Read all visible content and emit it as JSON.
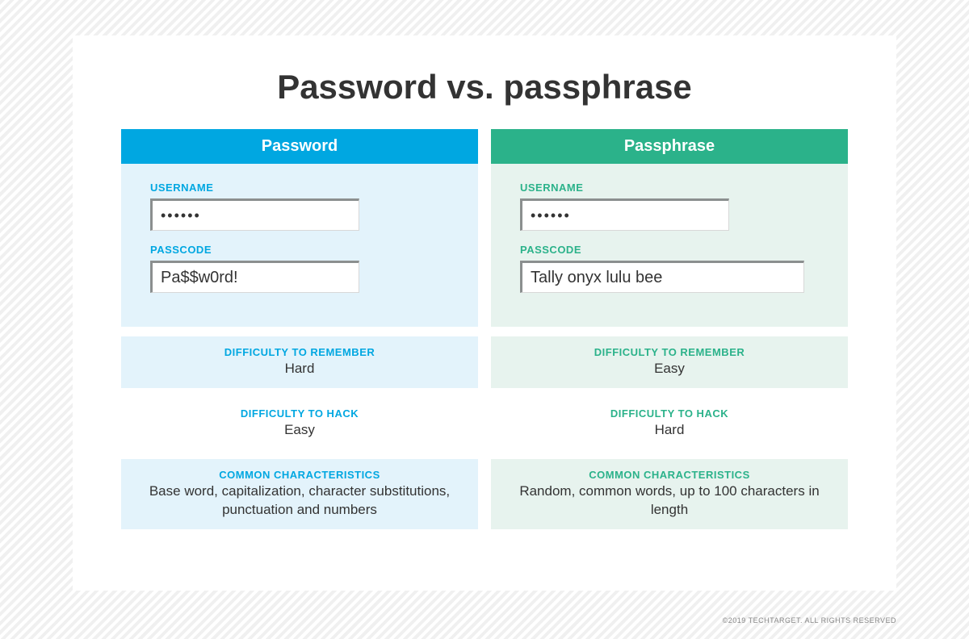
{
  "title": "Password vs. passphrase",
  "copyright": "©2019 TECHTARGET. ALL RIGHTS RESERVED",
  "labels": {
    "username": "USERNAME",
    "passcode": "PASSCODE",
    "difficulty_remember": "DIFFICULTY TO REMEMBER",
    "difficulty_hack": "DIFFICULTY TO HACK",
    "characteristics": "COMMON CHARACTERISTICS"
  },
  "password": {
    "header": "Password",
    "username_value": "••••••",
    "passcode_value": "Pa$$w0rd!",
    "difficulty_remember": "Hard",
    "difficulty_hack": "Easy",
    "characteristics": "Base word, capitalization, character substitutions, punctuation and numbers"
  },
  "passphrase": {
    "header": "Passphrase",
    "username_value": "••••••",
    "passcode_value": "Tally onyx lulu bee",
    "difficulty_remember": "Easy",
    "difficulty_hack": "Hard",
    "characteristics": "Random, common words, up to 100 characters in length"
  }
}
